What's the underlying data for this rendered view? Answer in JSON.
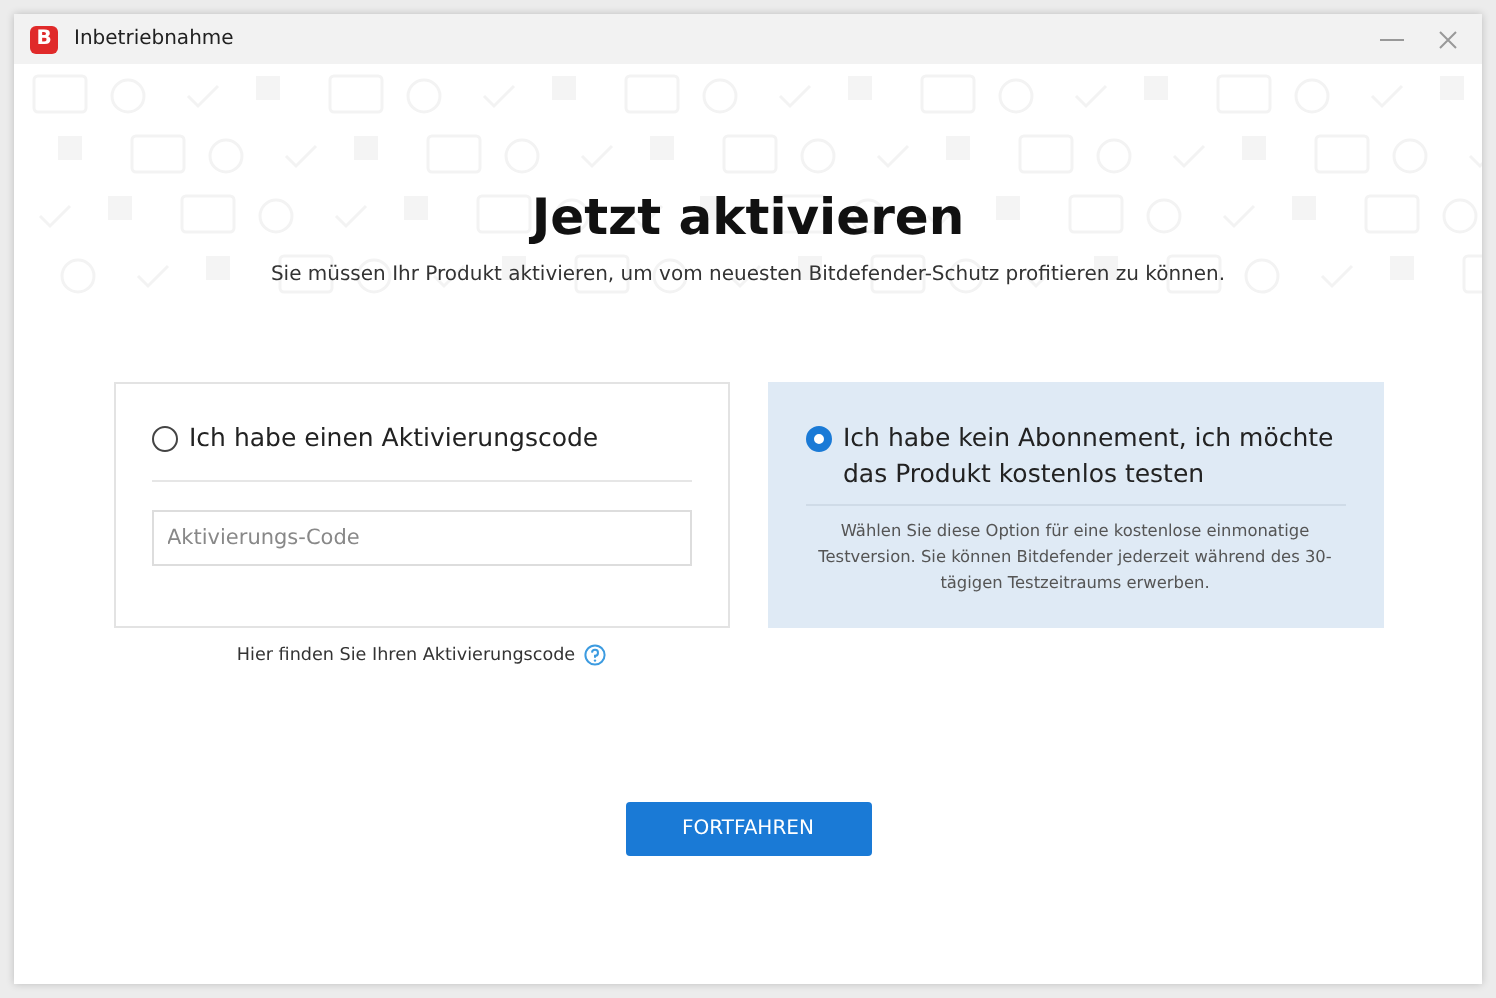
{
  "window": {
    "title": "Inbetriebnahme",
    "logo": "B"
  },
  "heading": "Jetzt aktivieren",
  "subtitle": "Sie müssen Ihr Produkt aktivieren, um vom neuesten Bitdefender-Schutz profitieren zu können.",
  "options": [
    {
      "kind": "code",
      "label": "Ich habe einen Aktivierungscode",
      "selected": false,
      "placeholder": "Aktivierungs-Code",
      "help_link": "Hier finden Sie Ihren Aktivierungscode"
    },
    {
      "kind": "trial",
      "label": "Ich habe kein Abonnement, ich möchte das Produkt kostenlos testen",
      "selected": true,
      "description": "Wählen Sie diese Option für eine kostenlose einmonatige Testversion. Sie können Bitdefender jederzeit während des 30-tägigen Testzeitraums erwerben."
    }
  ],
  "button": "FORTFAHREN"
}
